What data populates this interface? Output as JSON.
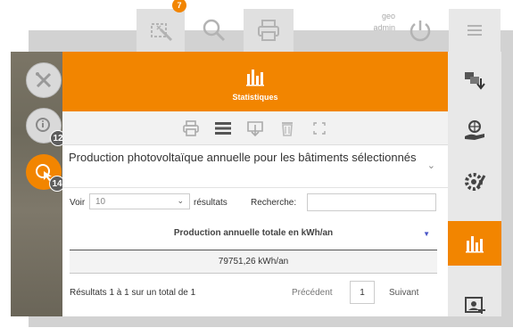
{
  "toolbar": {
    "badge_count": "7",
    "user_name": "geo",
    "user_role": "admin",
    "icons": [
      "selection-edit-icon",
      "search-icon",
      "print-icon",
      "power-icon",
      "hamburger-menu-icon"
    ]
  },
  "map_tools": {
    "items": [
      {
        "icon": "tools-cross-icon",
        "badge": ""
      },
      {
        "icon": "info-cursor-icon",
        "badge": "12"
      },
      {
        "icon": "select-cursor-icon",
        "badge": "14"
      }
    ]
  },
  "sidebar": {
    "items": [
      {
        "icon": "layers-download-icon"
      },
      {
        "icon": "globe-hand-icon"
      },
      {
        "icon": "settings-pencil-icon"
      },
      {
        "icon": "statistics-icon",
        "active": true
      },
      {
        "icon": "image-add-icon"
      }
    ]
  },
  "panel": {
    "title": "Statistiques",
    "query": "Production photovoltaïque annuelle pour les bâtiments sélectionnés",
    "voir_label": "Voir",
    "page_size": "10",
    "resultats_label": "résultats",
    "recherche_label": "Recherche:",
    "search_value": "",
    "column_header": "Production annuelle totale en kWh/an",
    "rows": [
      "79751,26 kWh/an"
    ],
    "summary": "Résultats 1 à 1 sur un total de 1",
    "prev_label": "Précédent",
    "current_page": "1",
    "next_label": "Suivant"
  },
  "colors": {
    "accent": "#f28500",
    "toolbar_bg": "#e8e8e8",
    "shadow": "#d2d2d2",
    "sort_icon": "#4a56c7"
  }
}
